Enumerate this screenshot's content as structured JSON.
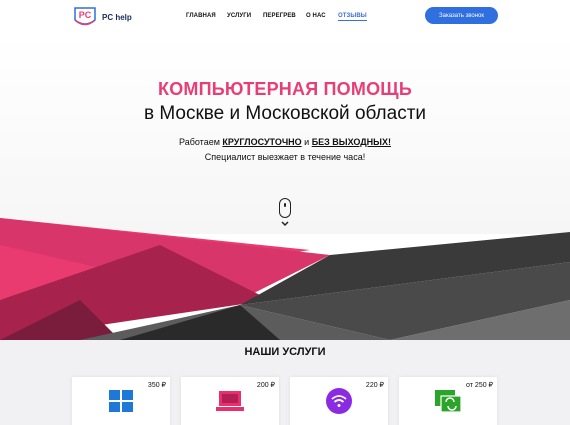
{
  "header": {
    "logo_text": "PC help",
    "logo_mark": "PC",
    "nav": [
      {
        "label": "ГЛАВНАЯ",
        "active": false
      },
      {
        "label": "УСЛУГИ",
        "active": false
      },
      {
        "label": "ПЕРЕГРЕВ",
        "active": false
      },
      {
        "label": "О НАС",
        "active": false
      },
      {
        "label": "ОТЗЫВЫ",
        "active": true
      }
    ],
    "cta_label": "Заказать звонок"
  },
  "hero": {
    "title": "КОМПЬЮТЕРНАЯ ПОМОЩЬ",
    "subtitle": "в Москве и Московской области",
    "line1_pre": "Работаем ",
    "line1_em1": "КРУГЛОСУТОЧНО",
    "line1_mid": " и ",
    "line1_em2": "БЕЗ ВЫХОДНЫХ!",
    "line2": "Специалист выезжает в течение часа!"
  },
  "services": {
    "title": "НАШИ УСЛУГИ",
    "cards": [
      {
        "price": "350 ₽",
        "icon": "windows-icon",
        "color": "#1e78d7"
      },
      {
        "price": "200 ₽",
        "icon": "laptop-icon",
        "color": "#e8306e"
      },
      {
        "price": "220 ₽",
        "icon": "wifi-icon",
        "color": "#8a2be2"
      },
      {
        "price": "от 250 ₽",
        "icon": "data-transfer-icon",
        "color": "#2aa52a"
      }
    ]
  },
  "colors": {
    "accent_blue": "#2f6fe0",
    "accent_pink": "#e83e78"
  }
}
